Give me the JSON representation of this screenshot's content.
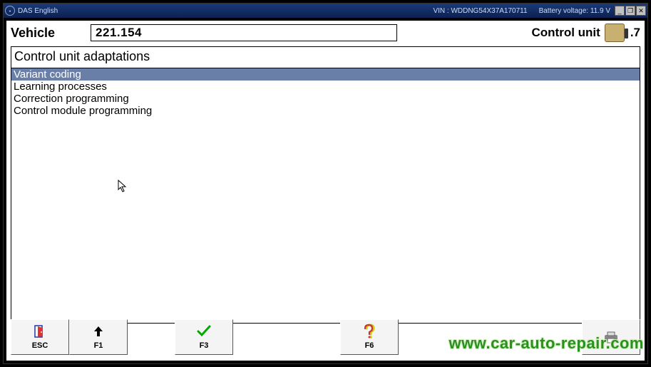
{
  "title_bar": {
    "app_title": "DAS English",
    "vin_label": "VIN : WDDNG54X37A170711",
    "battery_label": "Battery voltage: 11.9 V"
  },
  "header": {
    "vehicle_label": "Vehicle",
    "vehicle_value": "221.154",
    "control_unit_label": "Control unit",
    "control_unit_value": ".7"
  },
  "panel": {
    "title": "Control unit adaptations",
    "items": [
      {
        "label": "Variant coding",
        "selected": true
      },
      {
        "label": "Learning processes",
        "selected": false
      },
      {
        "label": "Correction programming",
        "selected": false
      },
      {
        "label": "Control module programming",
        "selected": false
      }
    ]
  },
  "buttons": {
    "esc": "ESC",
    "f1": "F1",
    "f3": "F3",
    "f6": "F6"
  },
  "watermark": "www.car-auto-repair.com"
}
